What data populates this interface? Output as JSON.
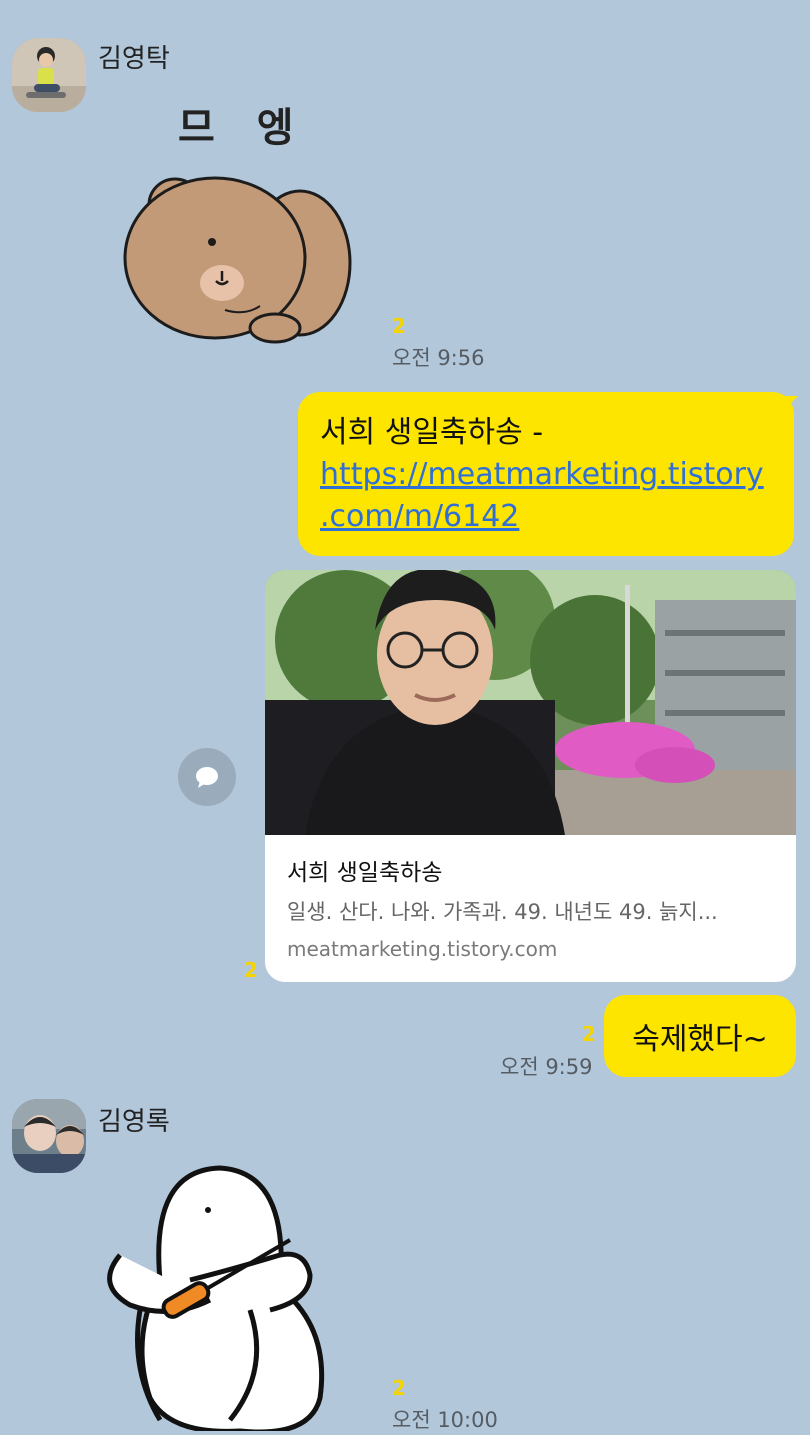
{
  "messages": [
    {
      "sender": "김영탁",
      "sticker": "bear-sticker",
      "sticker_text": "므 엥",
      "unread": "2",
      "time": "오전 9:56"
    },
    {
      "from_me": true,
      "text_prefix": "서희 생일축하송 -",
      "link_text": "https://meatmarketing.tistory.com/m/6142",
      "link_line1": "https://meatmarketing.tistory",
      "link_line2": ".com/m/6142"
    },
    {
      "from_me": true,
      "card_title": "서희 생일축하송",
      "card_desc": "일생. 산다. 나와. 가족과. 49. 내년도 49. 늙지...",
      "card_domain": "meatmarketing.tistory.com",
      "unread": "2"
    },
    {
      "from_me": true,
      "text": "숙제했다~",
      "unread": "2",
      "time": "오전 9:59"
    },
    {
      "sender": "김영록",
      "sticker": "white-character-sticker",
      "unread": "2",
      "time": "오전 10:00"
    }
  ],
  "icons": {
    "share": "speech-bubble-icon"
  },
  "colors": {
    "background": "#b2c7da",
    "my_bubble": "#fee500",
    "unread": "#f5d400",
    "link": "#2f6fd6"
  }
}
